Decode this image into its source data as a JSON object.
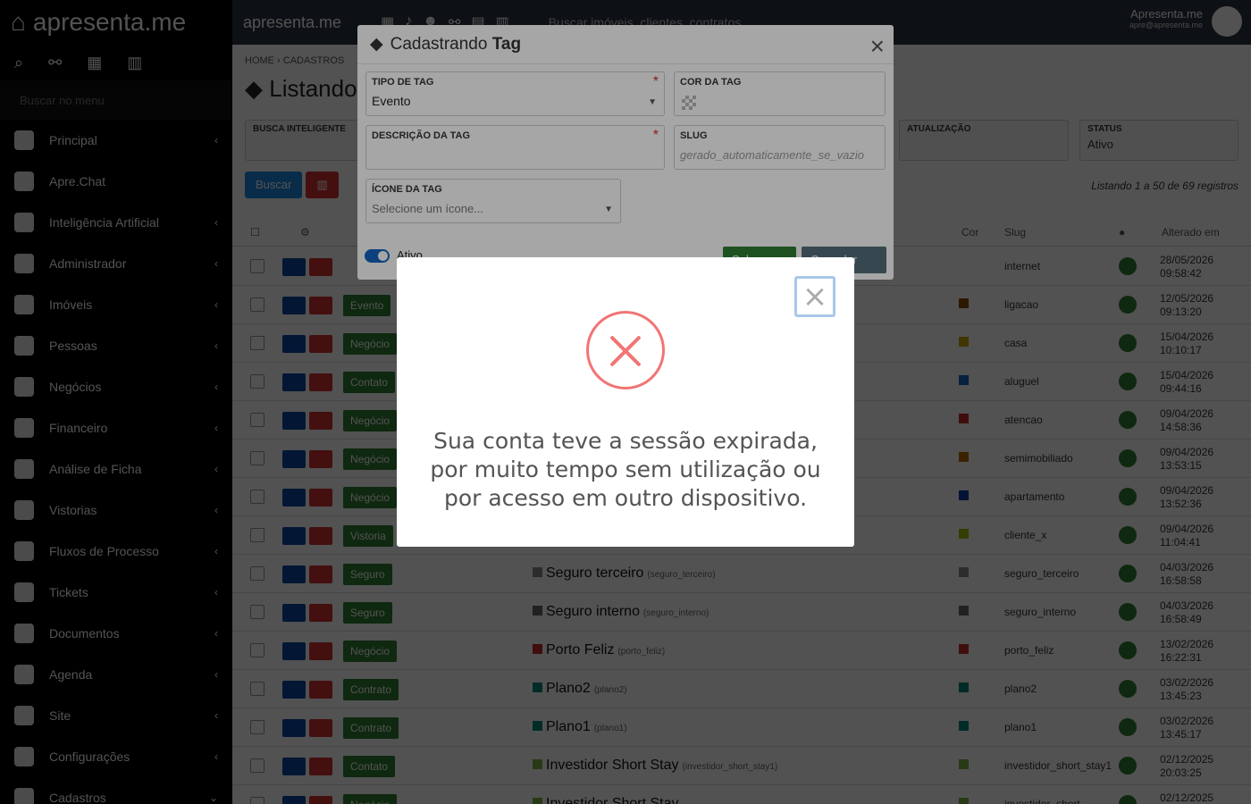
{
  "brand": "apresenta.me",
  "sidebar": {
    "search_placeholder": "Buscar no menu",
    "items": [
      {
        "label": "Principal",
        "chevron": "‹"
      },
      {
        "label": "Apre.Chat",
        "chevron": ""
      },
      {
        "label": "Inteligência Artificial",
        "chevron": "‹"
      },
      {
        "label": "Administrador",
        "chevron": "‹"
      },
      {
        "label": "Imóveis",
        "chevron": "‹"
      },
      {
        "label": "Pessoas",
        "chevron": "‹"
      },
      {
        "label": "Negócios",
        "chevron": "‹"
      },
      {
        "label": "Financeiro",
        "chevron": "‹"
      },
      {
        "label": "Análise de Ficha",
        "chevron": "‹"
      },
      {
        "label": "Vistorias",
        "chevron": "‹"
      },
      {
        "label": "Fluxos de Processo",
        "chevron": "‹"
      },
      {
        "label": "Tickets",
        "chevron": "‹"
      },
      {
        "label": "Documentos",
        "chevron": "‹"
      },
      {
        "label": "Agenda",
        "chevron": "‹"
      },
      {
        "label": "Site",
        "chevron": "‹"
      },
      {
        "label": "Configurações",
        "chevron": "‹"
      },
      {
        "label": "Cadastros",
        "chevron": "⌄"
      }
    ]
  },
  "topbar": {
    "search_placeholder": "Buscar imóveis, clientes, contratos...",
    "user_name": "Apresenta.me",
    "user_email": "apre@apresenta.me"
  },
  "breadcrumb": {
    "home": "HOME",
    "current": "CADASTROS"
  },
  "page_title": "Listando",
  "filters": {
    "smart_search": "BUSCA INTELIGENTE",
    "update": "ATUALIZAÇÃO",
    "status_label": "STATUS",
    "status_value": "Ativo"
  },
  "buttons": {
    "search": "Buscar"
  },
  "list_info": "Listando 1 a 50 de 69 registros",
  "table": {
    "headers": {
      "color": "Cor",
      "slug": "Slug",
      "altered": "Alterado em"
    },
    "rows": [
      {
        "type": "",
        "name": "",
        "slug_text": "",
        "swatch": "",
        "slug": "internet",
        "date": "28/05/2026",
        "time": "09:58:42"
      },
      {
        "type": "Evento",
        "name": "",
        "slug_text": "",
        "swatch": "#8a4a00",
        "slug": "ligacao",
        "date": "12/05/2026",
        "time": "09:13:20"
      },
      {
        "type": "Negócio",
        "name": "",
        "slug_text": "",
        "swatch": "#c9a400",
        "slug": "casa",
        "date": "15/04/2026",
        "time": "10:10:17"
      },
      {
        "type": "Contato",
        "name": "",
        "slug_text": "",
        "swatch": "#1565c0",
        "slug": "aluguel",
        "date": "15/04/2026",
        "time": "09:44:16"
      },
      {
        "type": "Negócio",
        "name": "",
        "slug_text": "",
        "swatch": "#c62828",
        "slug": "atencao",
        "date": "09/04/2026",
        "time": "14:58:36"
      },
      {
        "type": "Negócio",
        "name": "",
        "slug_text": "",
        "swatch": "#b56a00",
        "slug": "semimobiliado",
        "date": "09/04/2026",
        "time": "13:53:15"
      },
      {
        "type": "Negócio",
        "name": "",
        "slug_text": "",
        "swatch": "#0d3c9e",
        "slug": "apartamento",
        "date": "09/04/2026",
        "time": "13:52:36"
      },
      {
        "type": "Vistoria",
        "name": "",
        "slug_text": "",
        "swatch": "#9bc400",
        "slug": "cliente_x",
        "date": "09/04/2026",
        "time": "11:04:41"
      },
      {
        "type": "Seguro",
        "name": "Seguro terceiro",
        "slug_text": "(seguro_terceiro)",
        "swatch": "#888888",
        "slug": "seguro_terceiro",
        "date": "04/03/2026",
        "time": "16:58:58"
      },
      {
        "type": "Seguro",
        "name": "Seguro interno",
        "slug_text": "(seguro_interno)",
        "swatch": "#666666",
        "slug": "seguro_interno",
        "date": "04/03/2026",
        "time": "16:58:49"
      },
      {
        "type": "Negócio",
        "name": "Porto Feliz",
        "slug_text": "(porto_feliz)",
        "swatch": "#c62828",
        "slug": "porto_feliz",
        "date": "13/02/2026",
        "time": "16:22:31"
      },
      {
        "type": "Contrato",
        "name": "Plano2",
        "slug_text": "(plano2)",
        "swatch": "#00897b",
        "slug": "plano2",
        "date": "03/02/2026",
        "time": "13:45:23"
      },
      {
        "type": "Contrato",
        "name": "Plano1",
        "slug_text": "(plano1)",
        "swatch": "#00897b",
        "slug": "plano1",
        "date": "03/02/2026",
        "time": "13:45:17"
      },
      {
        "type": "Contato",
        "name": "Investidor Short Stay",
        "slug_text": "(investidor_short_stay1)",
        "swatch": "#7cb342",
        "slug": "investidor_short_stay1",
        "date": "02/12/2025",
        "time": "20:03:25"
      },
      {
        "type": "Negócio",
        "name": "Investidor Short Stay",
        "slug_text": "",
        "swatch": "#7cb342",
        "slug": "investidor_short_",
        "date": "02/12/2025",
        "time": ""
      }
    ]
  },
  "dialog": {
    "title_prefix": "Cadastrando ",
    "title_bold": "Tag",
    "close": "×",
    "tipo_label": "TIPO DE TAG",
    "tipo_value": "Evento",
    "cor_label": "COR DA TAG",
    "descricao_label": "DESCRIÇÃO DA TAG",
    "slug_label": "SLUG",
    "slug_placeholder": "gerado_automaticamente_se_vazio",
    "icone_label": "ÍCONE DA TAG",
    "icone_placeholder": "Selecione um ícone...",
    "ativo_label": "Ativo",
    "save": "Salvar",
    "cancel": "Cancelar",
    "required_mark": "*"
  },
  "alert": {
    "close": "×",
    "message_lines": [
      "Sua conta teve a sessão expirada,",
      "por muito tempo sem utilização ou",
      "por acesso em outro dispositivo."
    ],
    "icon": "error-x-icon",
    "accent": "#f27474"
  }
}
